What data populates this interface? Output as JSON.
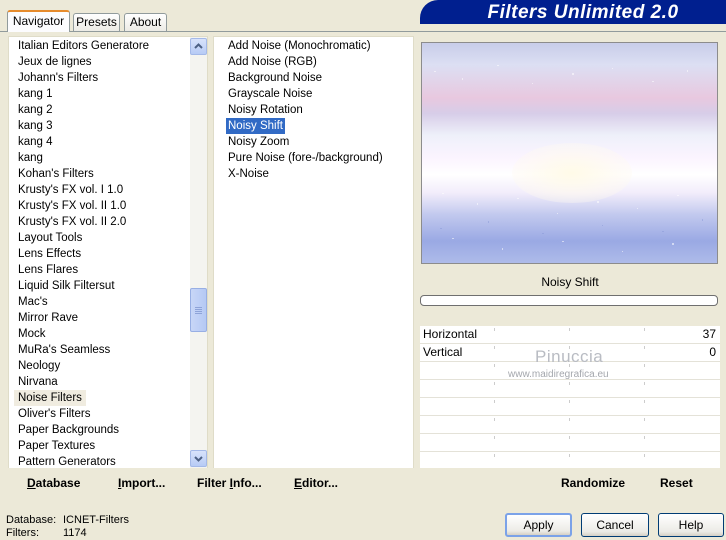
{
  "tabs": [
    {
      "label": "Navigator",
      "active": true
    },
    {
      "label": "Presets",
      "active": false
    },
    {
      "label": "About",
      "active": false
    }
  ],
  "app_title": "Filters Unlimited 2.0",
  "categories": [
    "Italian Editors Generatore",
    "Jeux de lignes",
    "Johann's Filters",
    "kang 1",
    "kang 2",
    "kang 3",
    "kang 4",
    "kang",
    "Kohan's Filters",
    "Krusty's FX vol. I 1.0",
    "Krusty's FX vol. II 1.0",
    "Krusty's FX vol. II 2.0",
    "Layout Tools",
    "Lens Effects",
    "Lens Flares",
    "Liquid Silk Filtersut",
    "Mac's",
    "Mirror Rave",
    "Mock",
    "MuRa's Seamless",
    "Neology",
    "Nirvana",
    "Noise Filters",
    "Oliver's Filters",
    "Paper Backgrounds",
    "Paper Textures",
    "Pattern Generators"
  ],
  "selected_category": "Noise Filters",
  "filters": [
    "Add Noise (Monochromatic)",
    "Add Noise (RGB)",
    "Background Noise",
    "Grayscale Noise",
    "Noisy Rotation",
    "Noisy Shift",
    "Noisy Zoom",
    "Pure Noise (fore-/background)",
    "X-Noise"
  ],
  "selected_filter": "Noisy Shift",
  "scroll_position": 0.62,
  "progress": 0,
  "preview": {
    "filter_name": "Noisy Shift"
  },
  "sliders": [
    {
      "label": "Horizontal",
      "value": "37"
    },
    {
      "label": "Vertical",
      "value": "0"
    }
  ],
  "watermark": {
    "name": "Pinuccia",
    "url": "www.maidiregrafica.eu"
  },
  "links": {
    "database": {
      "u": "D",
      "rest": "atabase"
    },
    "import": {
      "u": "I",
      "rest": "mport..."
    },
    "filter_info": {
      "pre": "Filter ",
      "u": "I",
      "rest": "nfo..."
    },
    "editor": {
      "u": "E",
      "rest": "ditor..."
    },
    "randomize": "Randomize",
    "reset": "Reset"
  },
  "footer": {
    "database_label": "Database:",
    "database_value": "ICNET-Filters",
    "filters_label": "Filters:",
    "filters_value": "1174"
  },
  "buttons": {
    "apply": "Apply",
    "cancel": "Cancel",
    "help": "Help"
  },
  "colors": {
    "banner": "#001f8f",
    "selection": "#316ac5",
    "accent_tab": "#e68b2c"
  }
}
